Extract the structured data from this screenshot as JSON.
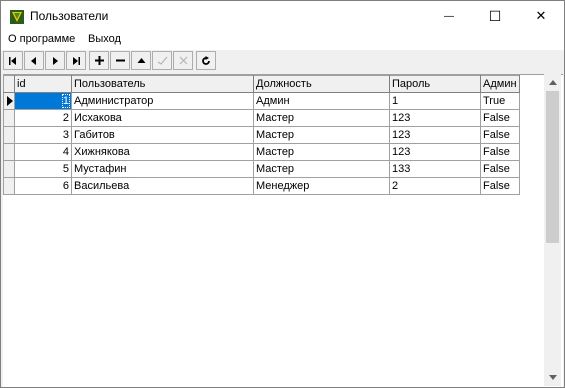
{
  "window": {
    "title": "Пользователи",
    "minimize_glyph": "—",
    "maximize_glyph": "☐",
    "close_glyph": "✕"
  },
  "menu": {
    "items": [
      {
        "label": "О программе"
      },
      {
        "label": "Выход"
      }
    ]
  },
  "toolbar": {
    "buttons": [
      {
        "name": "first-record",
        "icon": "first-icon",
        "enabled": true
      },
      {
        "name": "prior-record",
        "icon": "prior-icon",
        "enabled": true
      },
      {
        "name": "next-record",
        "icon": "next-icon",
        "enabled": true
      },
      {
        "name": "last-record",
        "icon": "last-icon",
        "enabled": true
      },
      {
        "name": "insert-record",
        "icon": "plus-icon",
        "enabled": true
      },
      {
        "name": "delete-record",
        "icon": "minus-icon",
        "enabled": true
      },
      {
        "name": "edit-record",
        "icon": "up-triangle-icon",
        "enabled": true
      },
      {
        "name": "post-edit",
        "icon": "checkmark-icon",
        "enabled": false
      },
      {
        "name": "cancel-edit",
        "icon": "cross-icon",
        "enabled": false
      },
      {
        "name": "refresh-data",
        "icon": "refresh-icon",
        "enabled": true
      }
    ]
  },
  "grid": {
    "columns": [
      "id",
      "Пользователь",
      "Должность",
      "Пароль",
      "Админ"
    ],
    "selected_row": 0,
    "rows": [
      [
        "1",
        "Администратор",
        "Админ",
        "1",
        "True"
      ],
      [
        "2",
        "Исхакова",
        "Мастер",
        "123",
        "False"
      ],
      [
        "3",
        "Габитов",
        "Мастер",
        "123",
        "False"
      ],
      [
        "4",
        "Хижнякова",
        "Мастер",
        "123",
        "False"
      ],
      [
        "5",
        "Мустафин",
        "Мастер",
        "133",
        "False"
      ],
      [
        "6",
        "Васильева",
        "Менеджер",
        "2",
        "False"
      ]
    ]
  },
  "colors": {
    "selection": "#0078d7",
    "grid_line": "#a0a0a0",
    "background": "#ffffff",
    "toolbar": "#f0f0f0"
  }
}
